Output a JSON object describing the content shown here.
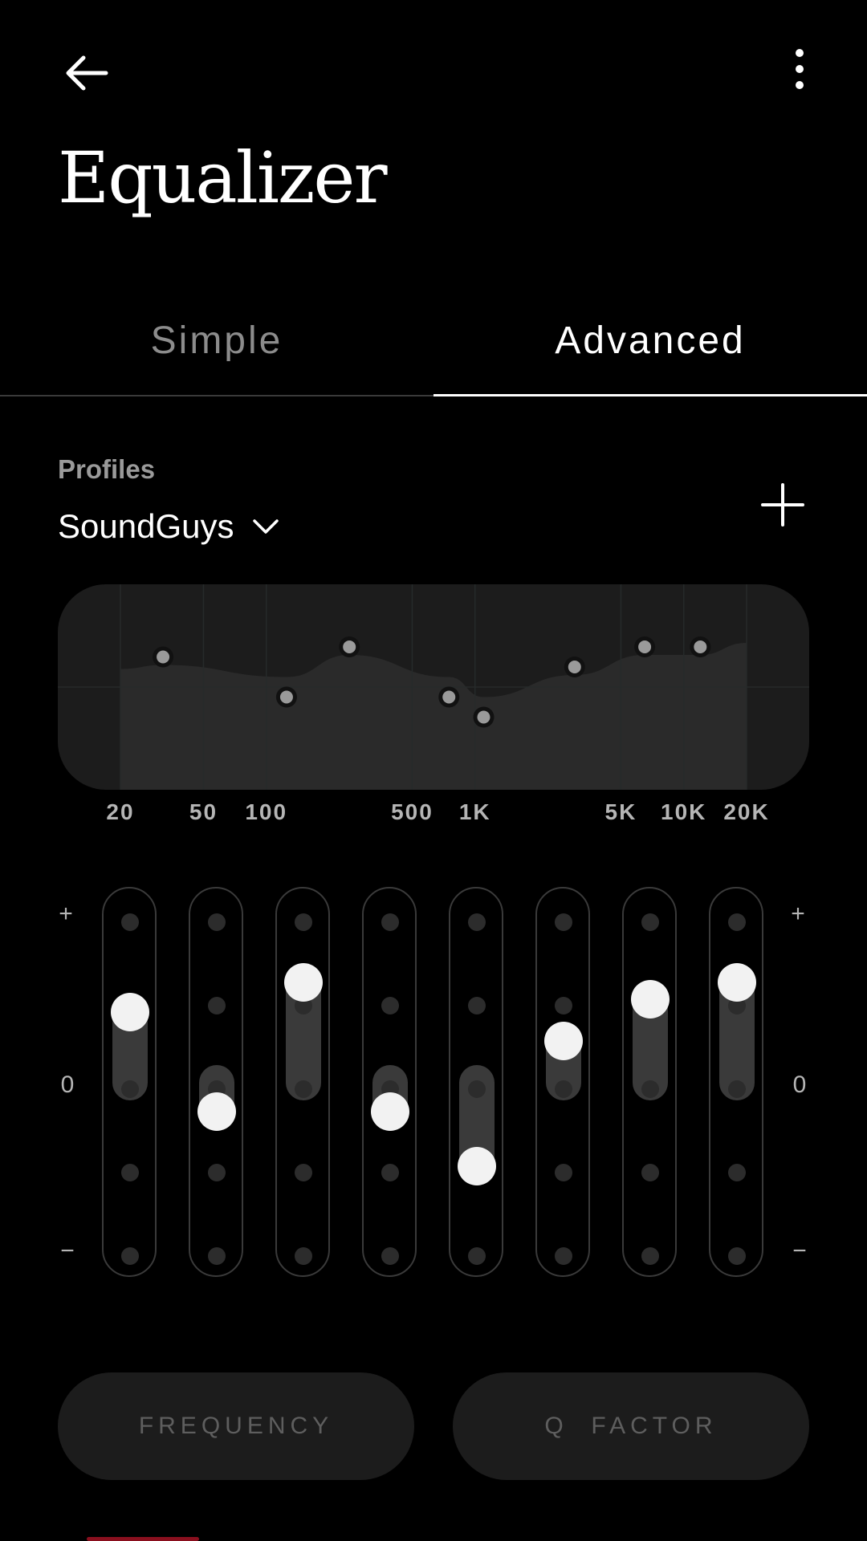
{
  "header": {
    "title": "Equalizer",
    "back_icon": "arrow-left-icon",
    "more_icon": "more-vertical-icon"
  },
  "tabs": [
    {
      "label": "Simple",
      "active": false
    },
    {
      "label": "Advanced",
      "active": true
    }
  ],
  "profiles": {
    "label": "Profiles",
    "selected": "SoundGuys",
    "add_icon": "plus-icon"
  },
  "graph": {
    "frequency_labels": [
      "20",
      "50",
      "100",
      "500",
      "1K",
      "5K",
      "10K",
      "20K"
    ],
    "points": [
      {
        "freq": "32",
        "gain": 1.5
      },
      {
        "freq": "125",
        "gain": -0.5
      },
      {
        "freq": "250",
        "gain": 2.0
      },
      {
        "freq": "750",
        "gain": -0.5
      },
      {
        "freq": "1.1K",
        "gain": -1.5
      },
      {
        "freq": "3K",
        "gain": 1.0
      },
      {
        "freq": "6.5K",
        "gain": 2.0
      },
      {
        "freq": "12K",
        "gain": 2.0
      }
    ]
  },
  "sliders": {
    "plus_label": "+",
    "zero_label": "0",
    "minus_label": "−",
    "bands": [
      {
        "gain": 0.85
      },
      {
        "gain": -0.35
      },
      {
        "gain": 1.2
      },
      {
        "gain": -0.35
      },
      {
        "gain": -1.0
      },
      {
        "gain": 0.5
      },
      {
        "gain": 1.0
      },
      {
        "gain": 1.2
      }
    ]
  },
  "buttons": {
    "frequency": "FREQUENCY",
    "q_factor": "Q  FACTOR"
  },
  "colors": {
    "background": "#000000",
    "panel": "#1c1c1c",
    "accent_underline": "#ffffff",
    "knob": "#f2f2f2"
  }
}
